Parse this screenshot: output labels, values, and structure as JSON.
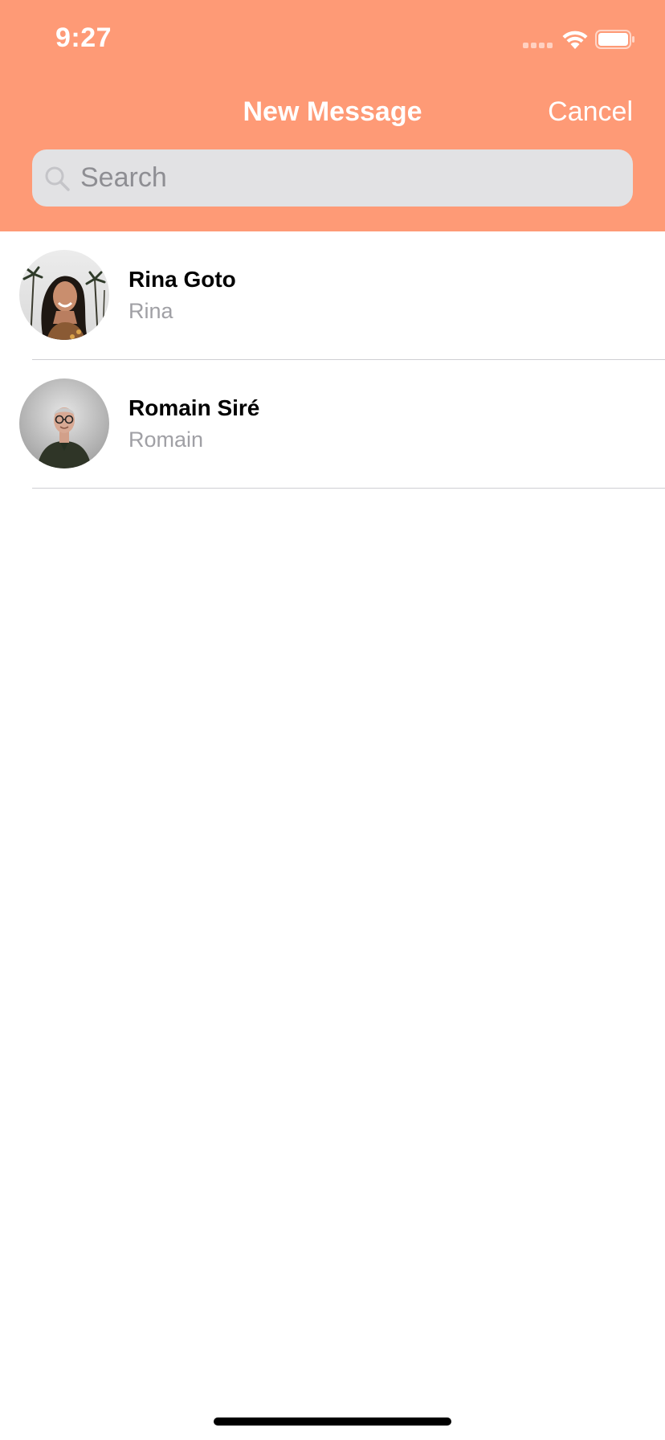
{
  "status_bar": {
    "time": "9:27"
  },
  "colors": {
    "header_background": "#FE9A76",
    "search_background": "#E2E2E4",
    "secondary_text": "#A0A0A5"
  },
  "nav": {
    "title": "New Message",
    "cancel_label": "Cancel"
  },
  "search": {
    "placeholder": "Search",
    "value": ""
  },
  "contacts": [
    {
      "name": "Rina Goto",
      "subtitle": "Rina",
      "avatar": "photo-woman-palm-trees"
    },
    {
      "name": "Romain Siré",
      "subtitle": "Romain",
      "avatar": "photo-man-glasses"
    }
  ]
}
